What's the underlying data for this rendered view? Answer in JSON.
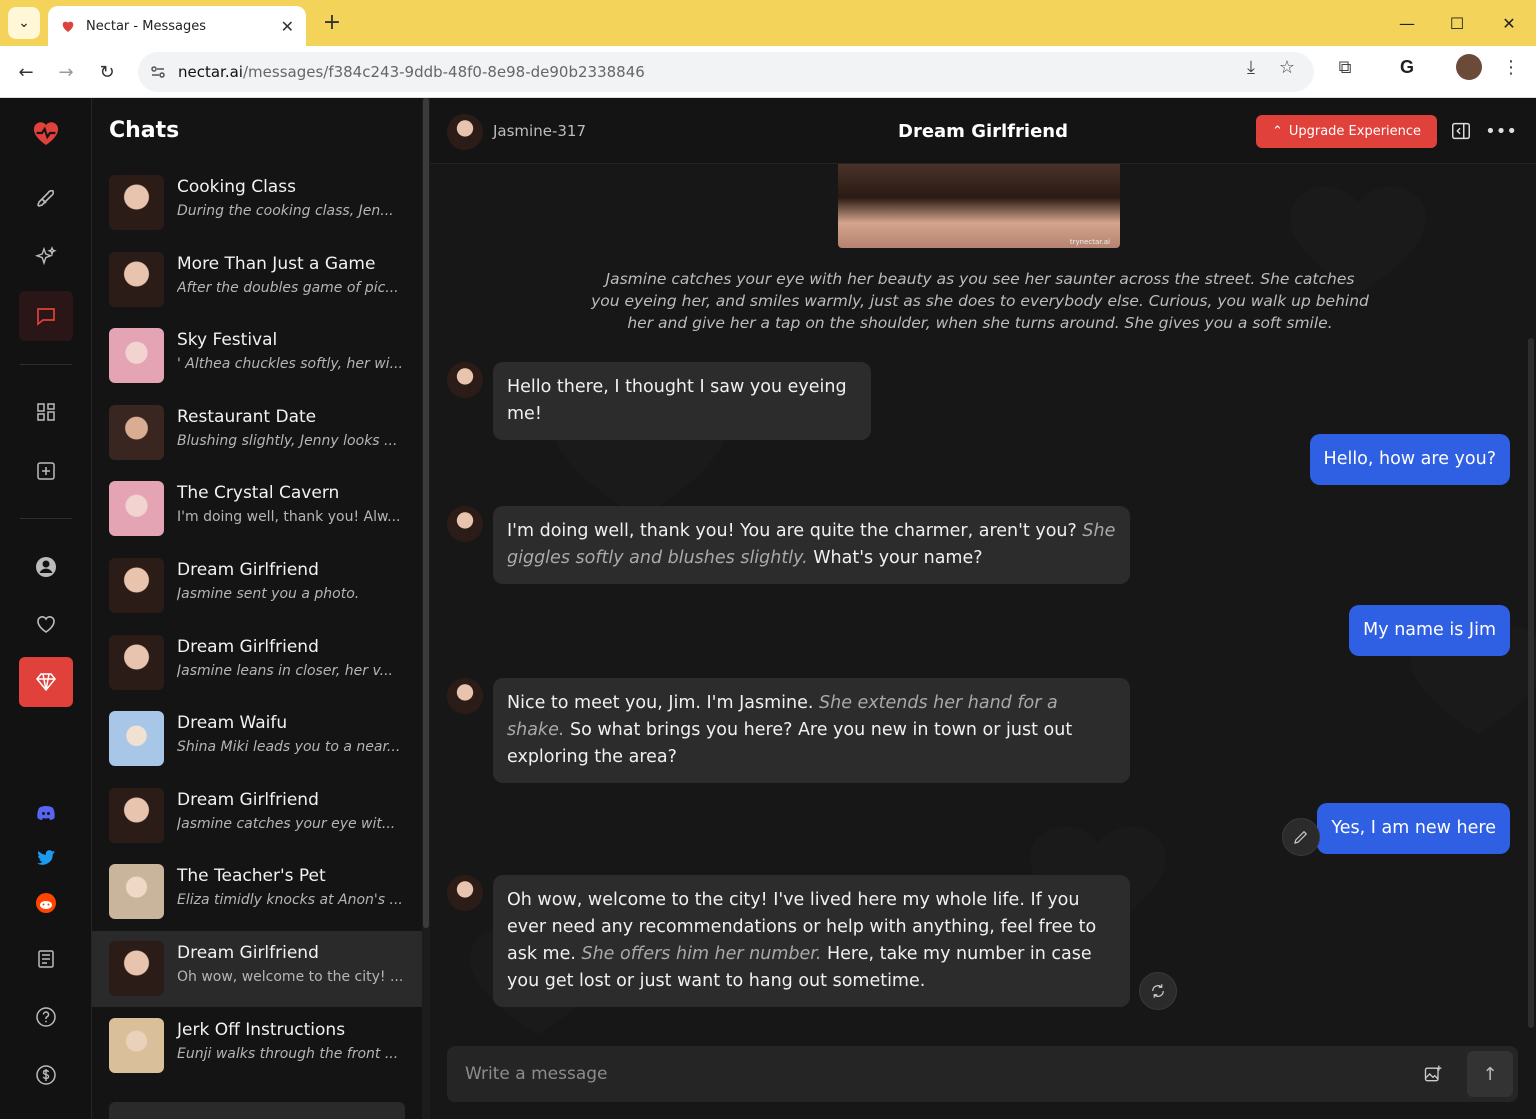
{
  "browser": {
    "tab_title": "Nectar - Messages",
    "url_host": "nectar.ai",
    "url_path": "/messages/f384c243-9ddb-48f0-8e98-de90b2338846"
  },
  "sidebar": {
    "title": "Chats",
    "chats": [
      {
        "name": "Cooking Class",
        "preview": "During the cooking class, Jen..."
      },
      {
        "name": "More Than Just a Game",
        "preview": "After the doubles game of pic..."
      },
      {
        "name": "Sky Festival",
        "preview": "' Althea chuckles softly, her wi..."
      },
      {
        "name": "Restaurant Date",
        "preview": "Blushing slightly, Jenny looks ..."
      },
      {
        "name": "The Crystal Cavern",
        "preview": "I'm doing well, thank you! Alw..."
      },
      {
        "name": "Dream Girlfriend",
        "preview": "Jasmine sent you a photo."
      },
      {
        "name": "Dream Girlfriend",
        "preview": "Jasmine leans in closer, her v..."
      },
      {
        "name": "Dream Waifu",
        "preview": "Shina Miki leads you to a near..."
      },
      {
        "name": "Dream Girlfriend",
        "preview": "Jasmine catches your eye wit..."
      },
      {
        "name": "The Teacher's Pet",
        "preview": "Eliza timidly knocks at Anon's ..."
      },
      {
        "name": "Dream Girlfriend",
        "preview": "Oh wow, welcome to the city! ..."
      },
      {
        "name": "Jerk Off Instructions",
        "preview": "Eunji walks through the front ..."
      }
    ]
  },
  "conversation": {
    "character_name": "Jasmine-317",
    "title": "Dream Girlfriend",
    "upgrade_label": "Upgrade Experience",
    "photo_watermark": "trynectar.ai",
    "narration": "Jasmine catches your eye with her beauty as you see her saunter across the street. She catches you eyeing her, and smiles warmly, just as she does to everybody else. Curious, you walk up behind her and give her a tap on the shoulder, when she turns around. She gives you a soft smile.",
    "messages": [
      {
        "from": "ai",
        "parts": [
          {
            "t": "Hello there, I thought I saw you eyeing me!"
          }
        ]
      },
      {
        "from": "user",
        "text": "Hello, how are you?"
      },
      {
        "from": "ai",
        "parts": [
          {
            "t": "I'm doing well, thank you! You are quite the charmer, aren't you? "
          },
          {
            "t": "She giggles softly and blushes slightly.",
            "i": true
          },
          {
            "t": " What's your name?"
          }
        ]
      },
      {
        "from": "user",
        "text": "My name is Jim"
      },
      {
        "from": "ai",
        "parts": [
          {
            "t": "Nice to meet you, Jim. I'm Jasmine. "
          },
          {
            "t": "She extends her hand for a shake.",
            "i": true
          },
          {
            "t": " So what brings you here? Are you new in town or just out exploring the area?"
          }
        ]
      },
      {
        "from": "user",
        "text": "Yes, I am new here"
      },
      {
        "from": "ai",
        "parts": [
          {
            "t": "Oh wow, welcome to the city! I've lived here my whole life. If you ever need any recommendations or help with anything, feel free to ask me. "
          },
          {
            "t": "She offers him her number.",
            "i": true
          },
          {
            "t": " Here, take my number in case you get lost or just want to hang out sometime."
          }
        ]
      }
    ],
    "composer_placeholder": "Write a message"
  },
  "colors": {
    "accent_red": "#e0413b",
    "user_bubble": "#2f5fe3",
    "browser_tab_strip": "#f3d35a"
  }
}
